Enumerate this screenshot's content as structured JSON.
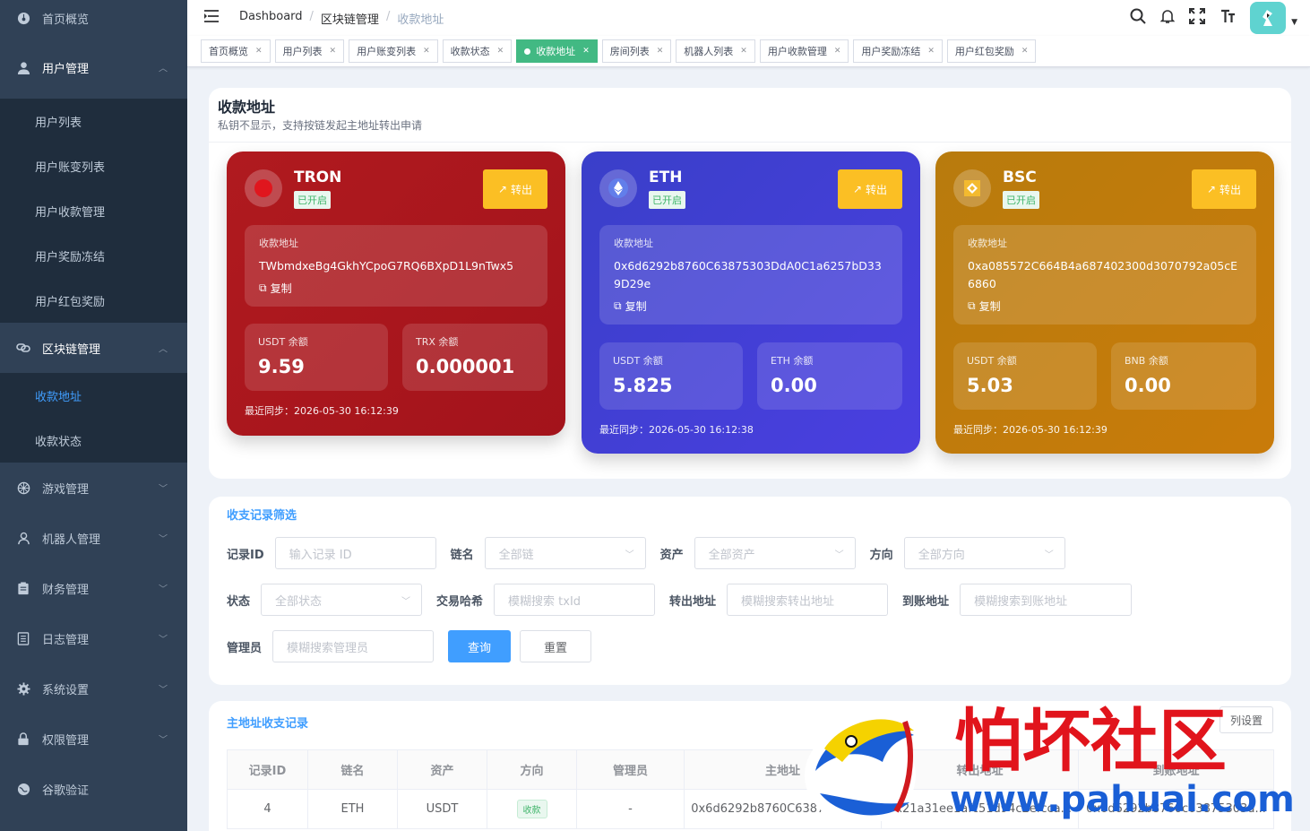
{
  "sidebar": {
    "items": [
      {
        "label": "首页概览",
        "icon": "dashboard-icon"
      },
      {
        "label": "用户管理",
        "icon": "user-icon",
        "open": true
      },
      {
        "label": "区块链管理",
        "icon": "chain-icon",
        "open": true
      },
      {
        "label": "游戏管理",
        "icon": "game-icon"
      },
      {
        "label": "机器人管理",
        "icon": "robot-icon"
      },
      {
        "label": "财务管理",
        "icon": "finance-icon"
      },
      {
        "label": "日志管理",
        "icon": "log-icon"
      },
      {
        "label": "系统设置",
        "icon": "gear-icon"
      },
      {
        "label": "权限管理",
        "icon": "lock-icon"
      },
      {
        "label": "谷歌验证",
        "icon": "google-icon"
      }
    ],
    "user_sub": [
      "用户列表",
      "用户账变列表",
      "用户收款管理",
      "用户奖励冻结",
      "用户红包奖励"
    ],
    "chain_sub": [
      "收款地址",
      "收款状态"
    ]
  },
  "breadcrumb": {
    "home": "Dashboard",
    "parent": "区块链管理",
    "current": "收款地址"
  },
  "tabs": [
    "首页概览",
    "用户列表",
    "用户账变列表",
    "收款状态",
    "收款地址",
    "房间列表",
    "机器人列表",
    "用户收款管理",
    "用户奖励冻结",
    "用户红包奖励"
  ],
  "page": {
    "title": "收款地址",
    "subtitle": "私钥不显示，支持按链发起主地址转出申请"
  },
  "cards": {
    "tron": {
      "name": "TRON",
      "status": "已开启",
      "out": "转出",
      "addr_label": "收款地址",
      "addr": "TWbmdxeBg4GkhYCpoG7RQ6BXpD1L9nTwx5",
      "copy": "复制",
      "b1_label": "USDT 余额",
      "b1": "9.59",
      "b2_label": "TRX 余额",
      "b2": "0.000001",
      "sync": "最近同步：2026-05-30 16:12:39"
    },
    "eth": {
      "name": "ETH",
      "status": "已开启",
      "out": "转出",
      "addr_label": "收款地址",
      "addr": "0x6d6292b8760C63875303DdA0C1a6257bD339D29e",
      "copy": "复制",
      "b1_label": "USDT 余额",
      "b1": "5.825",
      "b2_label": "ETH 余额",
      "b2": "0.00",
      "sync": "最近同步：2026-05-30 16:12:38"
    },
    "bsc": {
      "name": "BSC",
      "status": "已开启",
      "out": "转出",
      "addr_label": "收款地址",
      "addr": "0xa085572C664B4a687402300d3070792a05cE6860",
      "copy": "复制",
      "b1_label": "USDT 余额",
      "b1": "5.03",
      "b2_label": "BNB 余额",
      "b2": "0.00",
      "sync": "最近同步：2026-05-30 16:12:39"
    }
  },
  "filter": {
    "title": "收支记录筛选",
    "record_id": {
      "label": "记录ID",
      "placeholder": "输入记录 ID"
    },
    "chain": {
      "label": "链名",
      "placeholder": "全部链"
    },
    "asset": {
      "label": "资产",
      "placeholder": "全部资产"
    },
    "direction": {
      "label": "方向",
      "placeholder": "全部方向"
    },
    "status": {
      "label": "状态",
      "placeholder": "全部状态"
    },
    "txhash": {
      "label": "交易哈希",
      "placeholder": "模糊搜索 txId"
    },
    "from": {
      "label": "转出地址",
      "placeholder": "模糊搜索转出地址"
    },
    "to": {
      "label": "到账地址",
      "placeholder": "模糊搜索到账地址"
    },
    "admin": {
      "label": "管理员",
      "placeholder": "模糊搜索管理员"
    },
    "query": "查询",
    "reset": "重置"
  },
  "records": {
    "title": "主地址收支记录",
    "tools": "列设置",
    "headers": [
      "记录ID",
      "链名",
      "资产",
      "方向",
      "管理员",
      "主地址",
      "转出地址",
      "到账地址"
    ],
    "rows": [
      {
        "id": "4",
        "chain": "ETH",
        "asset": "USDT",
        "dir": "收款",
        "admin": "-",
        "main": "0x6d6292b8760C63875303D...",
        "from": "0x21a31ee1afc51d94c2efcca...",
        "to": "0x6d6292b8760c63875303d..."
      }
    ]
  },
  "watermark": {
    "brand": "怕坏社区",
    "url": "www.pahuai.com"
  },
  "colors": {
    "sidebar": "#304156",
    "accent": "#409eff",
    "tab_active": "#42b983",
    "tron": "#b01a1f",
    "eth": "#3a3fc9",
    "bsc": "#c97b0a",
    "out_btn": "#fbbf24"
  }
}
